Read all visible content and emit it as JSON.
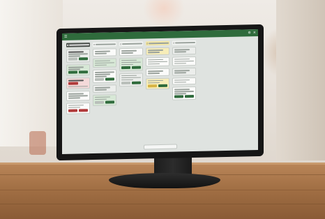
{
  "photo": {
    "description_colors": {
      "desk": "#a16f44",
      "monitor": "#161616",
      "wall": "#e9e4dd"
    }
  },
  "app": {
    "accent": "#2f6b3c",
    "danger": "#b03a3a",
    "columns": [
      {
        "id": "c1",
        "header_style": "dark"
      },
      {
        "id": "c2",
        "header_style": "light"
      },
      {
        "id": "c3",
        "header_style": "light"
      },
      {
        "id": "c4",
        "header_style": "light"
      },
      {
        "id": "c5",
        "header_style": "light"
      }
    ]
  }
}
